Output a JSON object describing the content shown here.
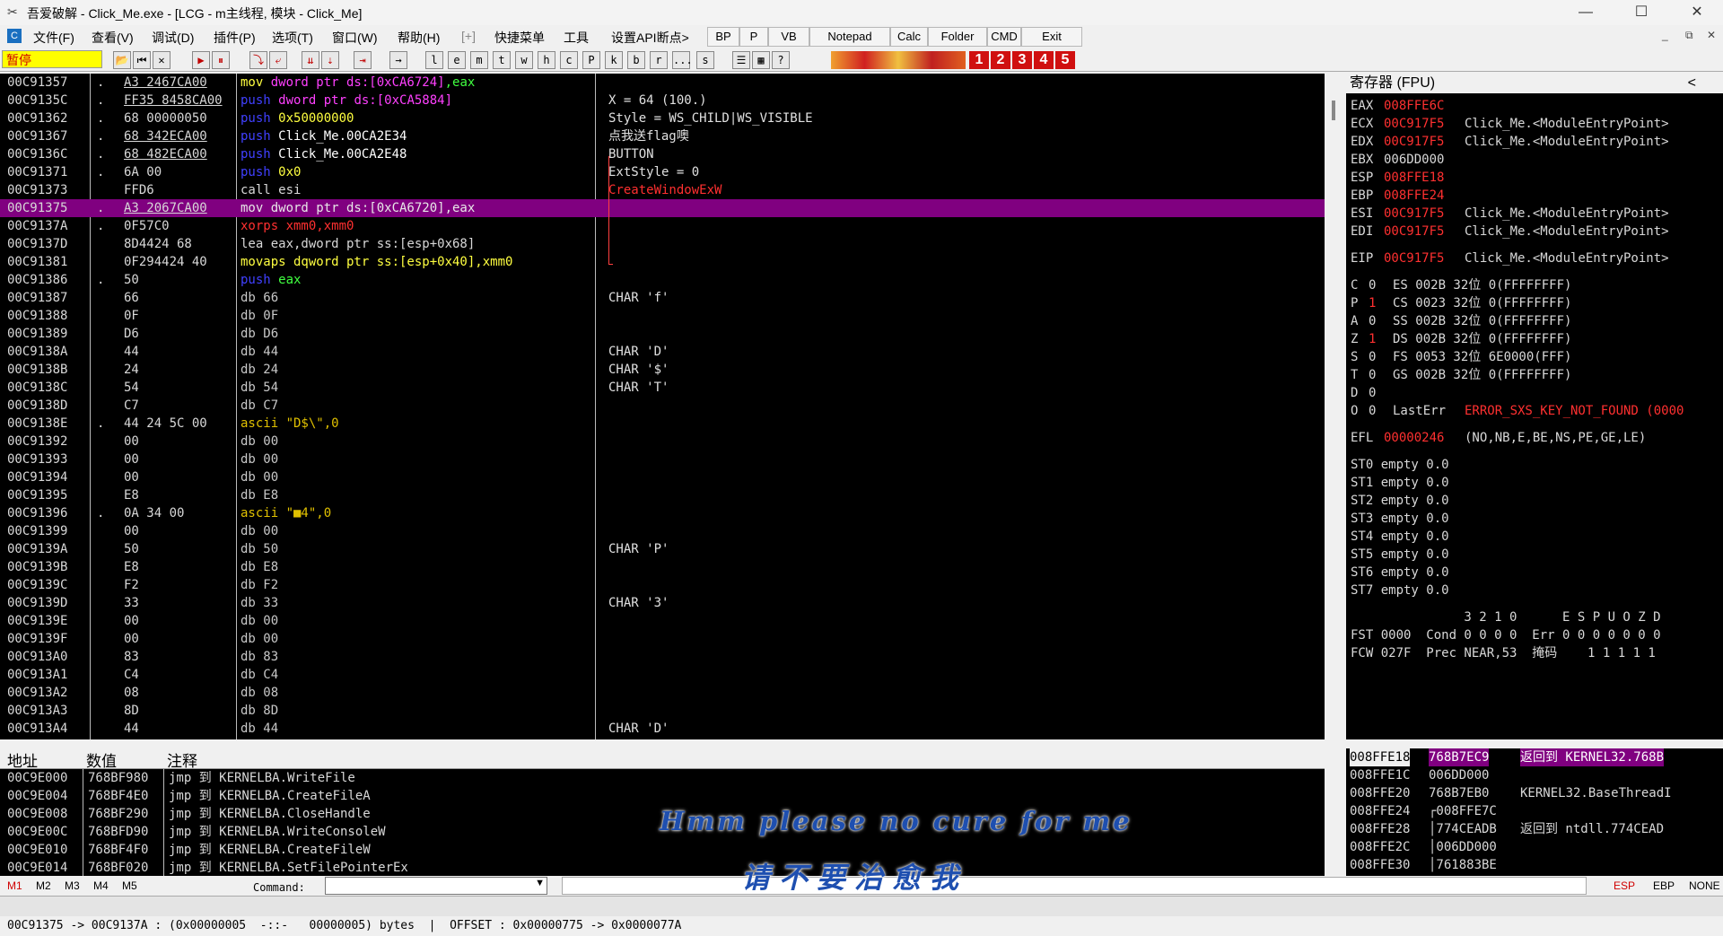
{
  "window": {
    "title": "吾爱破解 - Click_Me.exe - [LCG - m主线程, 模块 - Click_Me]",
    "minimize": "—",
    "maximize": "☐",
    "close": "✕"
  },
  "menu": {
    "items": [
      "文件(F)",
      "查看(V)",
      "调试(D)",
      "插件(P)",
      "选项(T)",
      "窗口(W)",
      "帮助(H)",
      "[+]",
      "快捷菜单",
      "工具",
      "设置API断点>"
    ],
    "custom_buttons": [
      "BP",
      "P",
      "VB",
      "Notepad",
      "Calc",
      "Folder",
      "CMD",
      "Exit"
    ],
    "mdi": [
      "_",
      "⧉",
      "✕"
    ]
  },
  "toolbar": {
    "status": "暂停",
    "buttons": [
      "📂",
      "⏮",
      "✕",
      "▶",
      "⏸",
      "⤵",
      "⤶",
      "⇊",
      "⇣",
      "⇥",
      "→"
    ],
    "letters": [
      "l",
      "e",
      "m",
      "t",
      "w",
      "h",
      "c",
      "P",
      "k",
      "b",
      "r",
      "...",
      "s"
    ],
    "extra": [
      "☰",
      "▦",
      "?"
    ],
    "numbers": [
      "1",
      "2",
      "3",
      "4",
      "5"
    ]
  },
  "disasm": {
    "rows": [
      {
        "addr": "00C91357",
        "mark": ".",
        "hex": "A3 2467CA00",
        "dis": "mov dword ptr ds:[0xCA6724],eax",
        "cmt": ""
      },
      {
        "addr": "00C9135C",
        "mark": ".",
        "hex": "FF35 8458CA00",
        "dis": "push dword ptr ds:[0xCA5884]",
        "cmt": "X = 64 (100.)"
      },
      {
        "addr": "00C91362",
        "mark": ".",
        "hex": "68 00000050",
        "dis": "push 0x50000000",
        "cmt": "Style = WS_CHILD|WS_VISIBLE"
      },
      {
        "addr": "00C91367",
        "mark": ".",
        "hex": "68 342ECA00",
        "dis": "push Click_Me.00CA2E34",
        "cmt": "点我送flag噢"
      },
      {
        "addr": "00C9136C",
        "mark": ".",
        "hex": "68 482ECA00",
        "dis": "push Click_Me.00CA2E48",
        "cmt": "BUTTON"
      },
      {
        "addr": "00C91371",
        "mark": ".",
        "hex": "6A 00",
        "dis": "push 0x0",
        "cmt": "ExtStyle = 0"
      },
      {
        "addr": "00C91373",
        "mark": "",
        "hex": "FFD6",
        "dis": "call esi",
        "cmt": "CreateWindowExW"
      },
      {
        "addr": "00C91375",
        "mark": ".",
        "hex": "A3 2067CA00",
        "dis": "mov dword ptr ds:[0xCA6720],eax",
        "cmt": ""
      },
      {
        "addr": "00C9137A",
        "mark": ".",
        "hex": "0F57C0",
        "dis": "xorps xmm0,xmm0",
        "cmt": ""
      },
      {
        "addr": "00C9137D",
        "mark": "",
        "hex": "8D4424 68",
        "dis": "lea eax,dword ptr ss:[esp+0x68]",
        "cmt": ""
      },
      {
        "addr": "00C91381",
        "mark": "",
        "hex": "0F294424 40",
        "dis": "movaps dqword ptr ss:[esp+0x40],xmm0",
        "cmt": ""
      },
      {
        "addr": "00C91386",
        "mark": ".",
        "hex": "50",
        "dis": "push eax",
        "cmt": ""
      },
      {
        "addr": "00C91387",
        "mark": "",
        "hex": "66",
        "dis": "db 66",
        "cmt": "CHAR 'f'"
      },
      {
        "addr": "00C91388",
        "mark": "",
        "hex": "0F",
        "dis": "db 0F",
        "cmt": ""
      },
      {
        "addr": "00C91389",
        "mark": "",
        "hex": "D6",
        "dis": "db D6",
        "cmt": ""
      },
      {
        "addr": "00C9138A",
        "mark": "",
        "hex": "44",
        "dis": "db 44",
        "cmt": "CHAR 'D'"
      },
      {
        "addr": "00C9138B",
        "mark": "",
        "hex": "24",
        "dis": "db 24",
        "cmt": "CHAR '$'"
      },
      {
        "addr": "00C9138C",
        "mark": "",
        "hex": "54",
        "dis": "db 54",
        "cmt": "CHAR 'T'"
      },
      {
        "addr": "00C9138D",
        "mark": "",
        "hex": "C7",
        "dis": "db C7",
        "cmt": ""
      },
      {
        "addr": "00C9138E",
        "mark": ".",
        "hex": "44 24 5C 00",
        "dis": "ascii \"D$\\\",0",
        "cmt": ""
      },
      {
        "addr": "00C91392",
        "mark": "",
        "hex": "00",
        "dis": "db 00",
        "cmt": ""
      },
      {
        "addr": "00C91393",
        "mark": "",
        "hex": "00",
        "dis": "db 00",
        "cmt": ""
      },
      {
        "addr": "00C91394",
        "mark": "",
        "hex": "00",
        "dis": "db 00",
        "cmt": ""
      },
      {
        "addr": "00C91395",
        "mark": "",
        "hex": "E8",
        "dis": "db E8",
        "cmt": ""
      },
      {
        "addr": "00C91396",
        "mark": ".",
        "hex": "0A 34 00",
        "dis": "ascii \"■4\",0",
        "cmt": ""
      },
      {
        "addr": "00C91399",
        "mark": "",
        "hex": "00",
        "dis": "db 00",
        "cmt": ""
      },
      {
        "addr": "00C9139A",
        "mark": "",
        "hex": "50",
        "dis": "db 50",
        "cmt": "CHAR 'P'"
      },
      {
        "addr": "00C9139B",
        "mark": "",
        "hex": "E8",
        "dis": "db E8",
        "cmt": ""
      },
      {
        "addr": "00C9139C",
        "mark": "",
        "hex": "F2",
        "dis": "db F2",
        "cmt": ""
      },
      {
        "addr": "00C9139D",
        "mark": "",
        "hex": "33",
        "dis": "db 33",
        "cmt": "CHAR '3'"
      },
      {
        "addr": "00C9139E",
        "mark": "",
        "hex": "00",
        "dis": "db 00",
        "cmt": ""
      },
      {
        "addr": "00C9139F",
        "mark": "",
        "hex": "00",
        "dis": "db 00",
        "cmt": ""
      },
      {
        "addr": "00C913A0",
        "mark": "",
        "hex": "83",
        "dis": "db 83",
        "cmt": ""
      },
      {
        "addr": "00C913A1",
        "mark": "",
        "hex": "C4",
        "dis": "db C4",
        "cmt": ""
      },
      {
        "addr": "00C913A2",
        "mark": "",
        "hex": "08",
        "dis": "db 08",
        "cmt": ""
      },
      {
        "addr": "00C913A3",
        "mark": "",
        "hex": "8D",
        "dis": "db 8D",
        "cmt": ""
      },
      {
        "addr": "00C913A4",
        "mark": "",
        "hex": "44",
        "dis": "db 44",
        "cmt": "CHAR 'D'"
      }
    ]
  },
  "registers": {
    "header": "寄存器 (FPU)",
    "collapse": "<",
    "lines": [
      {
        "l": "EAX",
        "v": "008FFE6C",
        "t": "",
        "red": true
      },
      {
        "l": "ECX",
        "v": "00C917F5",
        "t": "Click_Me.<ModuleEntryPoint>",
        "red": true
      },
      {
        "l": "EDX",
        "v": "00C917F5",
        "t": "Click_Me.<ModuleEntryPoint>",
        "red": true
      },
      {
        "l": "EBX",
        "v": "006DD000",
        "t": "",
        "red": false
      },
      {
        "l": "ESP",
        "v": "008FFE18",
        "t": "",
        "red": true
      },
      {
        "l": "EBP",
        "v": "008FFE24",
        "t": "",
        "red": true
      },
      {
        "l": "ESI",
        "v": "00C917F5",
        "t": "Click_Me.<ModuleEntryPoint>",
        "red": true
      },
      {
        "l": "EDI",
        "v": "00C917F5",
        "t": "Click_Me.<ModuleEntryPoint>",
        "red": true
      },
      {
        "l": "",
        "v": "",
        "t": "",
        "red": false
      },
      {
        "l": "EIP",
        "v": "00C917F5",
        "t": "Click_Me.<ModuleEntryPoint>",
        "red": true
      }
    ],
    "flags": [
      {
        "f": "C",
        "v": "0",
        "seg": "ES 002B 32位 0(FFFFFFFF)",
        "red": false
      },
      {
        "f": "P",
        "v": "1",
        "seg": "CS 0023 32位 0(FFFFFFFF)",
        "red": true
      },
      {
        "f": "A",
        "v": "0",
        "seg": "SS 002B 32位 0(FFFFFFFF)",
        "red": false
      },
      {
        "f": "Z",
        "v": "1",
        "seg": "DS 002B 32位 0(FFFFFFFF)",
        "red": true
      },
      {
        "f": "S",
        "v": "0",
        "seg": "FS 0053 32位 6E0000(FFF)",
        "red": false
      },
      {
        "f": "T",
        "v": "0",
        "seg": "GS 002B 32位 0(FFFFFFFF)",
        "red": false
      },
      {
        "f": "D",
        "v": "0",
        "seg": "",
        "red": false
      },
      {
        "f": "O",
        "v": "0",
        "seg": "LastErr",
        "red": false
      }
    ],
    "lasterr": "ERROR_SXS_KEY_NOT_FOUND (0000",
    "efl_label": "EFL",
    "efl_value": "00000246",
    "efl_text": "(NO,NB,E,BE,NS,PE,GE,LE)",
    "fpu": [
      "ST0 empty 0.0",
      "ST1 empty 0.0",
      "ST2 empty 0.0",
      "ST3 empty 0.0",
      "ST4 empty 0.0",
      "ST5 empty 0.0",
      "ST6 empty 0.0",
      "ST7 empty 0.0"
    ],
    "fst_hdr": "               3 2 1 0      E S P U O Z D",
    "fst": "FST 0000  Cond 0 0 0 0  Err 0 0 0 0 0 0 0",
    "fcw": "FCW 027F  Prec NEAR,53  掩码    1 1 1 1 1"
  },
  "dump": {
    "headers": [
      "地址",
      "数值",
      "注释"
    ],
    "rows": [
      {
        "addr": "00C9E000",
        "val": "768BF980",
        "note": "jmp 到 KERNELBA.WriteFile"
      },
      {
        "addr": "00C9E004",
        "val": "768BF4E0",
        "note": "jmp 到 KERNELBA.CreateFileA"
      },
      {
        "addr": "00C9E008",
        "val": "768BF290",
        "note": "jmp 到 KERNELBA.CloseHandle"
      },
      {
        "addr": "00C9E00C",
        "val": "768BFD90",
        "note": "jmp 到 KERNELBA.WriteConsoleW"
      },
      {
        "addr": "00C9E010",
        "val": "768BF4F0",
        "note": "jmp 到 KERNELBA.CreateFileW"
      },
      {
        "addr": "00C9E014",
        "val": "768BF020",
        "note": "jmp 到 KERNELBA.SetFilePointerEx"
      }
    ]
  },
  "stack": {
    "rows": [
      {
        "addr": "008FFE18",
        "val": "768B7EC9",
        "note": "返回到 KERNEL32.768B",
        "hl": true
      },
      {
        "addr": "008FFE1C",
        "val": "006DD000",
        "note": "",
        "hl": false
      },
      {
        "addr": "008FFE20",
        "val": "768B7EB0",
        "note": "KERNEL32.BaseThreadI",
        "hl": false
      },
      {
        "addr": "008FFE24",
        "val": "┌008FFE7C",
        "note": "",
        "hl": false
      },
      {
        "addr": "008FFE28",
        "val": "│774CEADB",
        "note": "返回到 ntdll.774CEAD",
        "hl": false
      },
      {
        "addr": "008FFE2C",
        "val": "│006DD000",
        "note": "",
        "hl": false
      },
      {
        "addr": "008FFE30",
        "val": "│761883BE",
        "note": "",
        "hl": false
      }
    ]
  },
  "cmdline": {
    "tabs": [
      "M1",
      "M2",
      "M3",
      "M4",
      "M5"
    ],
    "label": "Command:",
    "regs": [
      "ESP",
      "EBP",
      "NONE"
    ]
  },
  "status": "00C91375 -> 00C9137A : (0x00000005  -::-   00000005) bytes  |  OFFSET : 0x00000775 -> 0x0000077A",
  "overlay": {
    "en": "Hmm please no cure for me",
    "cn": "请不要治愈我"
  }
}
